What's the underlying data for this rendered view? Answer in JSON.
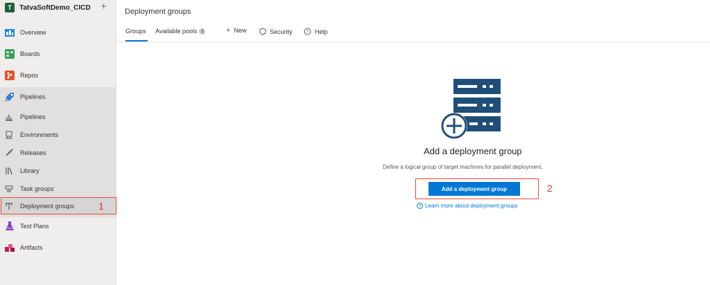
{
  "project": {
    "badge": "T",
    "name": "TatvaSoftDemo_CICD",
    "add": "+"
  },
  "nav": {
    "overview": "Overview",
    "boards": "Boards",
    "repos": "Repos",
    "pipelines": "Pipelines",
    "test_plans": "Test Plans",
    "artifacts": "Artifacts"
  },
  "pipelines_sub": {
    "pipelines": "Pipelines",
    "environments": "Environments",
    "releases": "Releases",
    "library": "Library",
    "task_groups": "Task groups",
    "deployment_groups": "Deployment groups"
  },
  "annotations": {
    "one": "1",
    "two": "2"
  },
  "header": {
    "title": "Deployment groups",
    "tabs": {
      "groups": "Groups",
      "available_pools": "Available pools",
      "available_pools_count": "1"
    },
    "commands": {
      "new": "New",
      "security": "Security",
      "help": "Help"
    }
  },
  "empty_state": {
    "title": "Add a deployment group",
    "description": "Define a logical group of target machines for parallel deployment.",
    "button": "Add a deployment group",
    "learn_more": "Learn more about deployment groups"
  },
  "colors": {
    "accent": "#0078d4",
    "highlight": "#e24a3b",
    "sidebar": "#efeeed"
  }
}
